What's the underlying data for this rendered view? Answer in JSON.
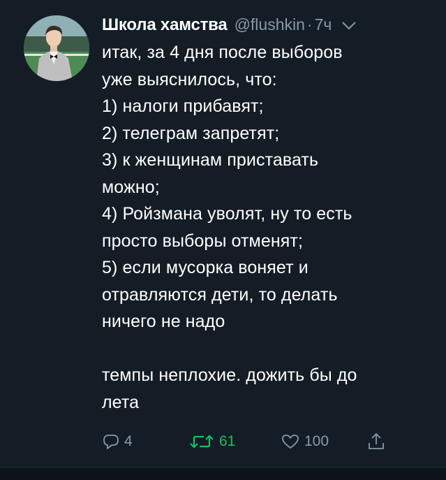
{
  "tweet": {
    "author_name": "Школа хамства",
    "handle": "@flushkin",
    "separator": "·",
    "time": "7ч",
    "text_lines": [
      "итак, за 4 дня после выборов",
      "уже выяснилось, что:",
      "1) налоги прибавят;",
      "2) телеграм запретят;",
      "3) к женщинам приставать",
      "можно;",
      "4) Ройзмана уволят, ну то есть",
      "просто выборы отменят;",
      "5) если мусорка воняет и",
      "отравляются дети, то делать",
      "ничего не надо",
      "",
      "темпы неплохие. дожить бы до",
      "лета"
    ],
    "actions": {
      "reply_icon": "reply-icon",
      "reply_count": "4",
      "retweet_icon": "retweet-icon",
      "retweet_count": "61",
      "like_icon": "heart-icon",
      "like_count": "100",
      "share_icon": "share-icon"
    },
    "colors": {
      "background": "#141d26",
      "secondary_text": "#8899a6",
      "retweet_active": "#17bf63",
      "primary_text": "#ffffff"
    }
  }
}
